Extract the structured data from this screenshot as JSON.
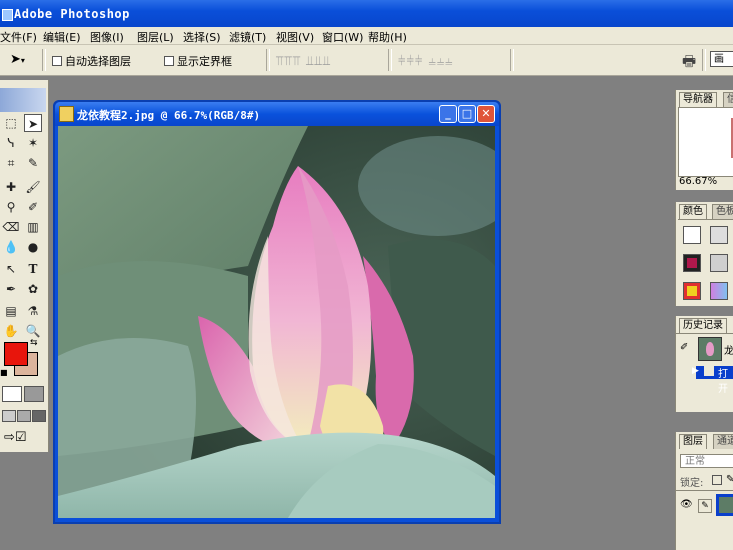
{
  "app": {
    "title": "Adobe Photoshop"
  },
  "menu": [
    "文件(F)",
    "编辑(E)",
    "图像(I)",
    "图层(L)",
    "选择(S)",
    "滤镜(T)",
    "视图(V)",
    "窗口(W)",
    "帮助(H)"
  ],
  "options": {
    "auto_select_label": "自动选择图层",
    "show_bounds_label": "显示定界框",
    "right_label": "画笔"
  },
  "document": {
    "title": "龙依教程2.jpg @ 66.7%(RGB/8#)"
  },
  "panels": {
    "navigator_tab": "导航器",
    "navigator_tab2": "信",
    "zoom": "66.67%",
    "color_tab": "颜色",
    "color_tab2": "色板",
    "history_tab": "历史记录",
    "history_snapshot": "龙",
    "history_open": "打开",
    "layers_tab": "图层",
    "channels_tab": "通道",
    "blend_mode": "正常",
    "lock_label": "锁定:"
  },
  "colors": {
    "foreground": "#e8150c",
    "background": "#dcb49c",
    "titlebar": "#0a4fd9"
  }
}
